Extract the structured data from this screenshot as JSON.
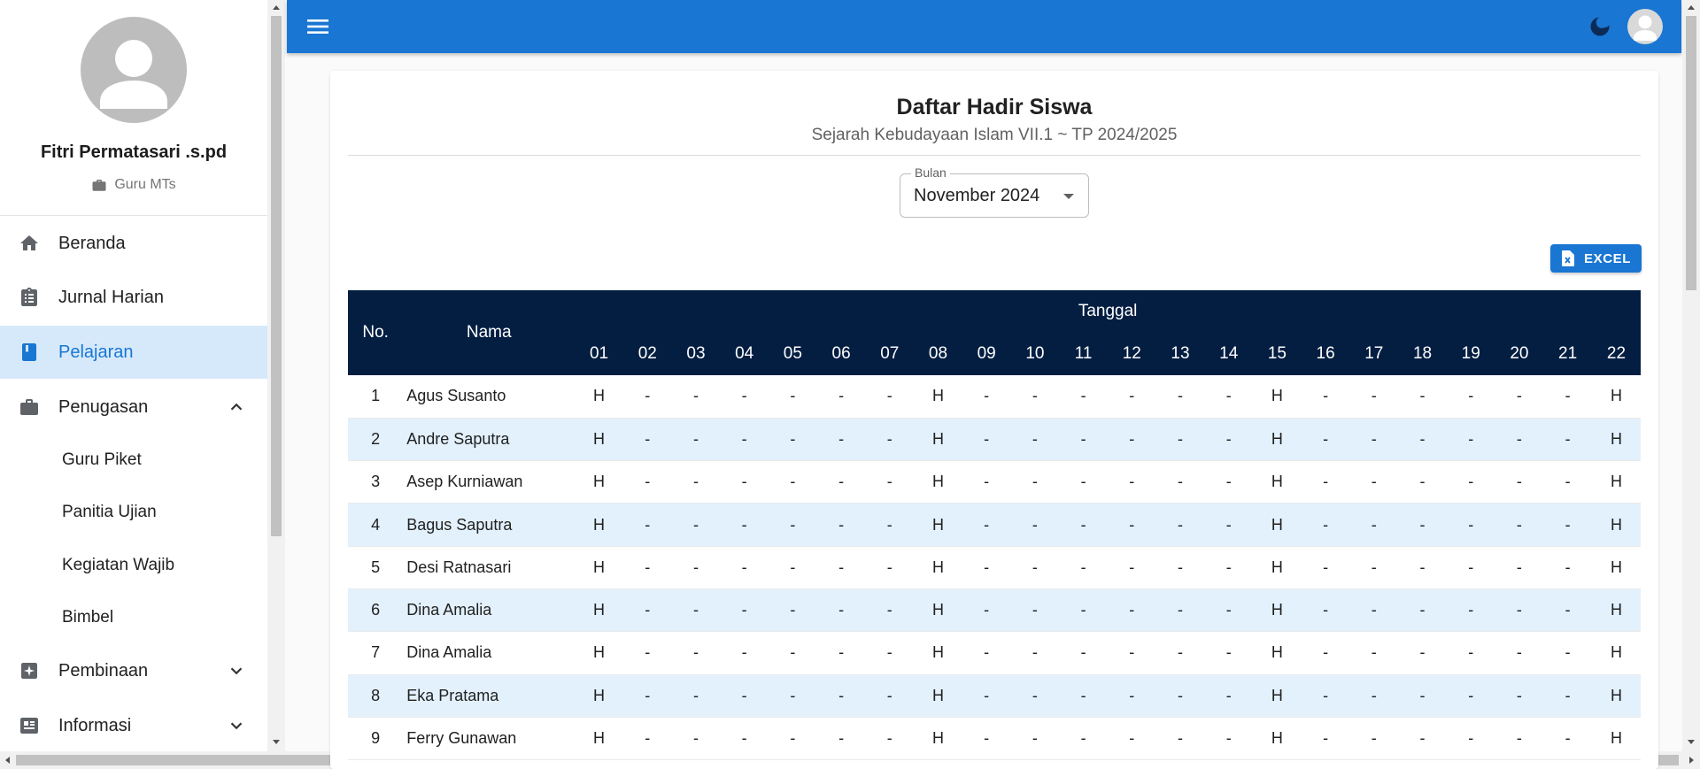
{
  "sidebar": {
    "profile": {
      "name": "Fitri Permatasari .s.pd",
      "role": "Guru MTs"
    },
    "items": [
      {
        "label": "Beranda",
        "icon": "home-icon"
      },
      {
        "label": "Jurnal Harian",
        "icon": "clipboard-list-icon"
      },
      {
        "label": "Pelajaran",
        "icon": "book-icon",
        "active": true
      },
      {
        "label": "Penugasan",
        "icon": "briefcase-icon",
        "expanded": true
      },
      {
        "label": "Pembinaan",
        "icon": "sparkle-icon",
        "expanded": false
      },
      {
        "label": "Informasi",
        "icon": "newspaper-icon",
        "expanded": false
      }
    ],
    "penugasan_sub": [
      "Guru Piket",
      "Panitia Ujian",
      "Kegiatan Wajib",
      "Bimbel"
    ]
  },
  "colors": {
    "primary": "#1976d2",
    "table_header": "#041e42",
    "row_stripe": "#e3f1fd",
    "active_nav": "#d6e9fb"
  },
  "page": {
    "title": "Daftar Hadir Siswa",
    "subtitle": "Sejarah Kebudayaan Islam VII.1 ~ TP 2024/2025",
    "month_label": "Bulan",
    "month_value": "November 2024",
    "excel_label": "EXCEL"
  },
  "table": {
    "col_no": "No.",
    "col_nama": "Nama",
    "col_tanggal": "Tanggal",
    "days": [
      "01",
      "02",
      "03",
      "04",
      "05",
      "06",
      "07",
      "08",
      "09",
      "10",
      "11",
      "12",
      "13",
      "14",
      "15",
      "16",
      "17",
      "18",
      "19",
      "20",
      "21",
      "22"
    ],
    "rows": [
      {
        "no": "1",
        "nama": "Agus Susanto",
        "marks": [
          "H",
          "-",
          "-",
          "-",
          "-",
          "-",
          "-",
          "H",
          "-",
          "-",
          "-",
          "-",
          "-",
          "-",
          "H",
          "-",
          "-",
          "-",
          "-",
          "-",
          "-",
          "H"
        ]
      },
      {
        "no": "2",
        "nama": "Andre Saputra",
        "marks": [
          "H",
          "-",
          "-",
          "-",
          "-",
          "-",
          "-",
          "H",
          "-",
          "-",
          "-",
          "-",
          "-",
          "-",
          "H",
          "-",
          "-",
          "-",
          "-",
          "-",
          "-",
          "H"
        ]
      },
      {
        "no": "3",
        "nama": "Asep Kurniawan",
        "marks": [
          "H",
          "-",
          "-",
          "-",
          "-",
          "-",
          "-",
          "H",
          "-",
          "-",
          "-",
          "-",
          "-",
          "-",
          "H",
          "-",
          "-",
          "-",
          "-",
          "-",
          "-",
          "H"
        ]
      },
      {
        "no": "4",
        "nama": "Bagus Saputra",
        "marks": [
          "H",
          "-",
          "-",
          "-",
          "-",
          "-",
          "-",
          "H",
          "-",
          "-",
          "-",
          "-",
          "-",
          "-",
          "H",
          "-",
          "-",
          "-",
          "-",
          "-",
          "-",
          "H"
        ]
      },
      {
        "no": "5",
        "nama": "Desi Ratnasari",
        "marks": [
          "H",
          "-",
          "-",
          "-",
          "-",
          "-",
          "-",
          "H",
          "-",
          "-",
          "-",
          "-",
          "-",
          "-",
          "H",
          "-",
          "-",
          "-",
          "-",
          "-",
          "-",
          "H"
        ]
      },
      {
        "no": "6",
        "nama": "Dina Amalia",
        "marks": [
          "H",
          "-",
          "-",
          "-",
          "-",
          "-",
          "-",
          "H",
          "-",
          "-",
          "-",
          "-",
          "-",
          "-",
          "H",
          "-",
          "-",
          "-",
          "-",
          "-",
          "-",
          "H"
        ]
      },
      {
        "no": "7",
        "nama": "Dina Amalia",
        "marks": [
          "H",
          "-",
          "-",
          "-",
          "-",
          "-",
          "-",
          "H",
          "-",
          "-",
          "-",
          "-",
          "-",
          "-",
          "H",
          "-",
          "-",
          "-",
          "-",
          "-",
          "-",
          "H"
        ]
      },
      {
        "no": "8",
        "nama": "Eka Pratama",
        "marks": [
          "H",
          "-",
          "-",
          "-",
          "-",
          "-",
          "-",
          "H",
          "-",
          "-",
          "-",
          "-",
          "-",
          "-",
          "H",
          "-",
          "-",
          "-",
          "-",
          "-",
          "-",
          "H"
        ]
      },
      {
        "no": "9",
        "nama": "Ferry Gunawan",
        "marks": [
          "H",
          "-",
          "-",
          "-",
          "-",
          "-",
          "-",
          "H",
          "-",
          "-",
          "-",
          "-",
          "-",
          "-",
          "H",
          "-",
          "-",
          "-",
          "-",
          "-",
          "-",
          "H"
        ]
      }
    ]
  }
}
